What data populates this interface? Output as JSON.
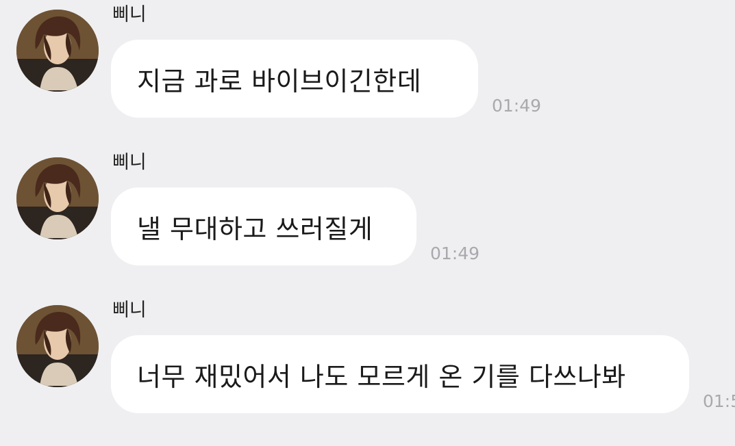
{
  "conversation": {
    "messages": [
      {
        "sender": "삐니",
        "text": "지금 과로 바이브이긴한데",
        "time": "01:49",
        "avatar_icon": "profile-photo"
      },
      {
        "sender": "삐니",
        "text": "낼 무대하고 쓰러질게",
        "time": "01:49",
        "avatar_icon": "profile-photo"
      },
      {
        "sender": "삐니",
        "text": "너무 재밌어서 나도 모르게 온 기를 다쓰나봐",
        "time": "01:5",
        "avatar_icon": "profile-photo"
      }
    ]
  },
  "colors": {
    "background": "#efeff1",
    "bubble": "#ffffff",
    "text": "#1a1a1a",
    "sender_text": "#222222",
    "time_text": "#a9a9ad"
  }
}
